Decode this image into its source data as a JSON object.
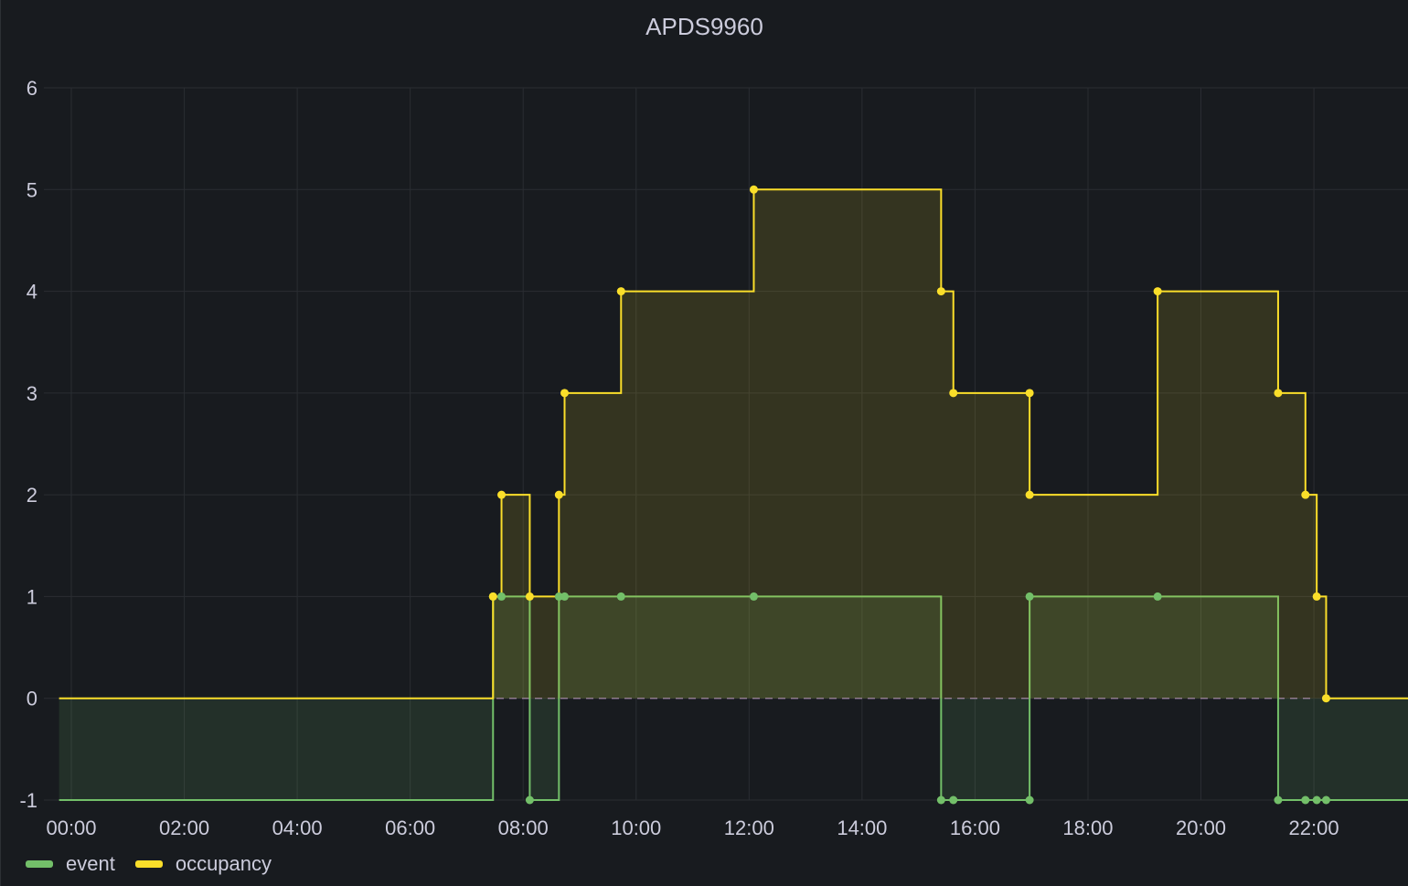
{
  "panel": {
    "title": "APDS9960"
  },
  "colors": {
    "event": "#73bf69",
    "occupancy": "#fade2a",
    "grid": "#2a2d32",
    "threshold": "#8a6f9a"
  },
  "legend": [
    {
      "name": "event",
      "color": "#73bf69"
    },
    {
      "name": "occupancy",
      "color": "#fade2a"
    }
  ],
  "chart_data": {
    "type": "line",
    "title": "APDS9960",
    "step": "after",
    "xlim": [
      "23:47",
      "23:37"
    ],
    "ylim": [
      -1,
      6
    ],
    "y_ticks": [
      -1,
      0,
      1,
      2,
      3,
      4,
      5,
      6
    ],
    "x_ticks": [
      "00:00",
      "02:00",
      "04:00",
      "06:00",
      "08:00",
      "10:00",
      "12:00",
      "14:00",
      "16:00",
      "18:00",
      "20:00",
      "22:00"
    ],
    "grid": true,
    "legend_position": "bottom-left",
    "threshold_line": 0,
    "series": [
      {
        "name": "occupancy",
        "points": [
          [
            "23:47",
            0
          ],
          [
            "07:28",
            1
          ],
          [
            "07:37",
            2
          ],
          [
            "08:07",
            1
          ],
          [
            "08:38",
            2
          ],
          [
            "08:44",
            3
          ],
          [
            "09:44",
            4
          ],
          [
            "12:05",
            5
          ],
          [
            "15:24",
            4
          ],
          [
            "15:37",
            3
          ],
          [
            "16:58",
            3
          ],
          [
            "16:58",
            2
          ],
          [
            "19:14",
            4
          ],
          [
            "21:22",
            3
          ],
          [
            "21:51",
            2
          ],
          [
            "22:03",
            1
          ],
          [
            "22:13",
            0
          ],
          [
            "23:37",
            0
          ]
        ]
      },
      {
        "name": "event",
        "points": [
          [
            "23:47",
            -1
          ],
          [
            "07:28",
            1
          ],
          [
            "07:37",
            1
          ],
          [
            "08:07",
            -1
          ],
          [
            "08:38",
            1
          ],
          [
            "08:44",
            1
          ],
          [
            "09:44",
            1
          ],
          [
            "12:05",
            1
          ],
          [
            "15:24",
            -1
          ],
          [
            "15:37",
            -1
          ],
          [
            "16:58",
            -1
          ],
          [
            "16:58",
            1
          ],
          [
            "19:14",
            1
          ],
          [
            "21:22",
            -1
          ],
          [
            "21:51",
            -1
          ],
          [
            "22:03",
            -1
          ],
          [
            "22:13",
            -1
          ],
          [
            "23:37",
            -1
          ]
        ]
      }
    ]
  }
}
